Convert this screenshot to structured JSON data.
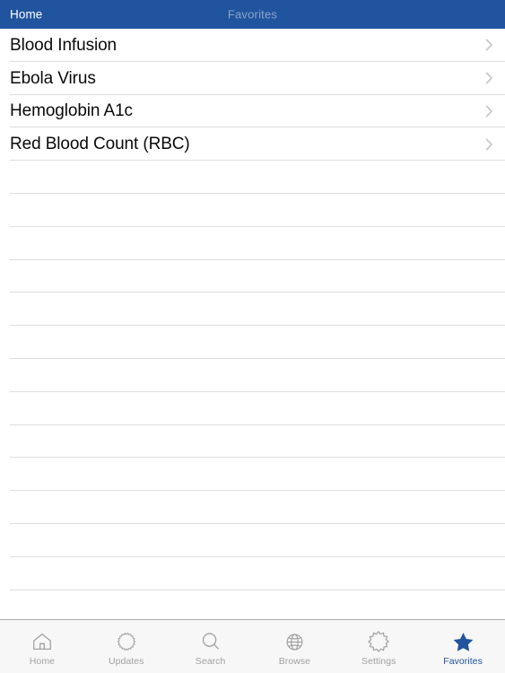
{
  "navbar": {
    "back_label": "Home",
    "title": "Favorites",
    "background_color": "#20549e",
    "back_color": "#ffffff",
    "title_color": "#8ba4c9"
  },
  "list": {
    "items": [
      {
        "label": "Blood Infusion",
        "accessory": "chevron-right-icon"
      },
      {
        "label": "Ebola Virus",
        "accessory": "chevron-right-icon"
      },
      {
        "label": "Hemoglobin A1c",
        "accessory": "chevron-right-icon"
      },
      {
        "label": "Red Blood Count (RBC)",
        "accessory": "chevron-right-icon"
      }
    ],
    "empty_row_count": 13,
    "separator_color": "#dededf",
    "text_color": "#0a0a0a",
    "chevron_color": "#c7c7cc"
  },
  "tabbar": {
    "background_color": "#f7f7f7",
    "border_color": "#a9a9a9",
    "inactive_color": "#a1a1a3",
    "active_color": "#20549e",
    "tabs": [
      {
        "label": "Home",
        "icon": "house-icon",
        "active": false
      },
      {
        "label": "Updates",
        "icon": "cog-small-icon",
        "active": false
      },
      {
        "label": "Search",
        "icon": "magnifier-icon",
        "active": false
      },
      {
        "label": "Browse",
        "icon": "globe-icon",
        "active": false
      },
      {
        "label": "Settings",
        "icon": "cog-large-icon",
        "active": false
      },
      {
        "label": "Favorites",
        "icon": "star-filled-icon",
        "active": true
      }
    ]
  }
}
